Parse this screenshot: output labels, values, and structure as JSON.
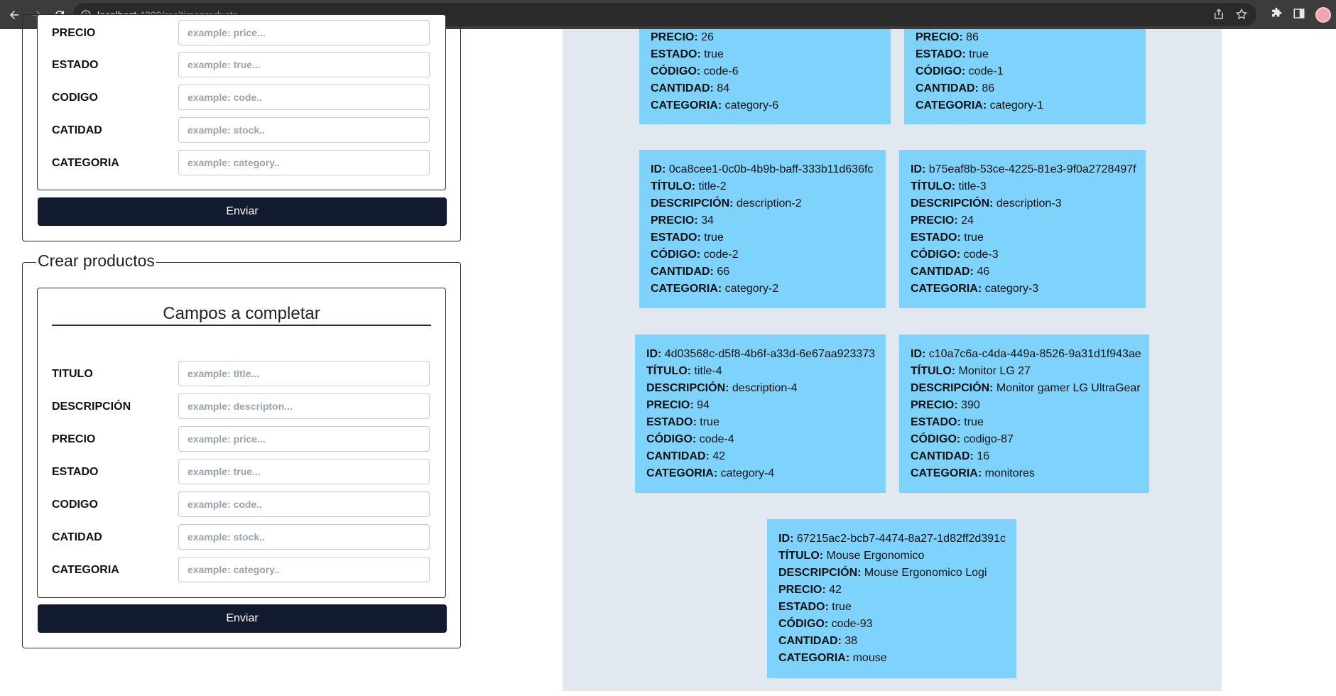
{
  "browser": {
    "url_host": "localhost",
    "url_rest": ":4000/realtimeproducts"
  },
  "top_form": {
    "fields": [
      {
        "label": "PRECIO",
        "placeholder": "example: price..."
      },
      {
        "label": "ESTADO",
        "placeholder": "example: true..."
      },
      {
        "label": "CODIGO",
        "placeholder": "example: code.."
      },
      {
        "label": "CATIDAD",
        "placeholder": "example: stock.."
      },
      {
        "label": "CATEGORIA",
        "placeholder": "example: category.."
      }
    ],
    "submit_label": "Enviar"
  },
  "create_form": {
    "legend": "Crear productos",
    "section_title": "Campos a completar",
    "fields": [
      {
        "label": "TITULO",
        "placeholder": "example: title..."
      },
      {
        "label": "DESCRIPCIÓN",
        "placeholder": "example: descripton..."
      },
      {
        "label": "PRECIO",
        "placeholder": "example: price..."
      },
      {
        "label": "ESTADO",
        "placeholder": "example: true..."
      },
      {
        "label": "CODIGO",
        "placeholder": "example: code.."
      },
      {
        "label": "CATIDAD",
        "placeholder": "example: stock.."
      },
      {
        "label": "CATEGORIA",
        "placeholder": "example: category.."
      }
    ],
    "submit_label": "Enviar"
  },
  "field_keys": {
    "id": "ID:",
    "title": "TÍTULO:",
    "description": "DESCRIPCIÓN:",
    "price": "PRECIO:",
    "status": "ESTADO:",
    "code": "CÓDIGO:",
    "stock": "CANTIDAD:",
    "category": "CATEGORIA:"
  },
  "products": [
    {
      "price": "26",
      "status": "true",
      "code": "code-6",
      "stock": "84",
      "category": "category-6"
    },
    {
      "price": "86",
      "status": "true",
      "code": "code-1",
      "stock": "86",
      "category": "category-1"
    },
    {
      "id": "0ca8cee1-0c0b-4b9b-baff-333b11d636fc",
      "title": "title-2",
      "description": "description-2",
      "price": "34",
      "status": "true",
      "code": "code-2",
      "stock": "66",
      "category": "category-2"
    },
    {
      "id": "b75eaf8b-53ce-4225-81e3-9f0a2728497f",
      "title": "title-3",
      "description": "description-3",
      "price": "24",
      "status": "true",
      "code": "code-3",
      "stock": "46",
      "category": "category-3"
    },
    {
      "id": "4d03568c-d5f8-4b6f-a33d-6e67aa923373",
      "title": "title-4",
      "description": "description-4",
      "price": "94",
      "status": "true",
      "code": "code-4",
      "stock": "42",
      "category": "category-4"
    },
    {
      "id": "c10a7c6a-c4da-449a-8526-9a31d1f943ae",
      "title": "Monitor LG 27",
      "description": "Monitor gamer LG UltraGear",
      "price": "390",
      "status": "true",
      "code": "codigo-87",
      "stock": "16",
      "category": "monitores"
    },
    {
      "id": "67215ac2-bcb7-4474-8a27-1d82ff2d391c",
      "title": "Mouse Ergonomico",
      "description": "Mouse Ergonomico Logi",
      "price": "42",
      "status": "true",
      "code": "code-93",
      "stock": "38",
      "category": "mouse"
    }
  ]
}
